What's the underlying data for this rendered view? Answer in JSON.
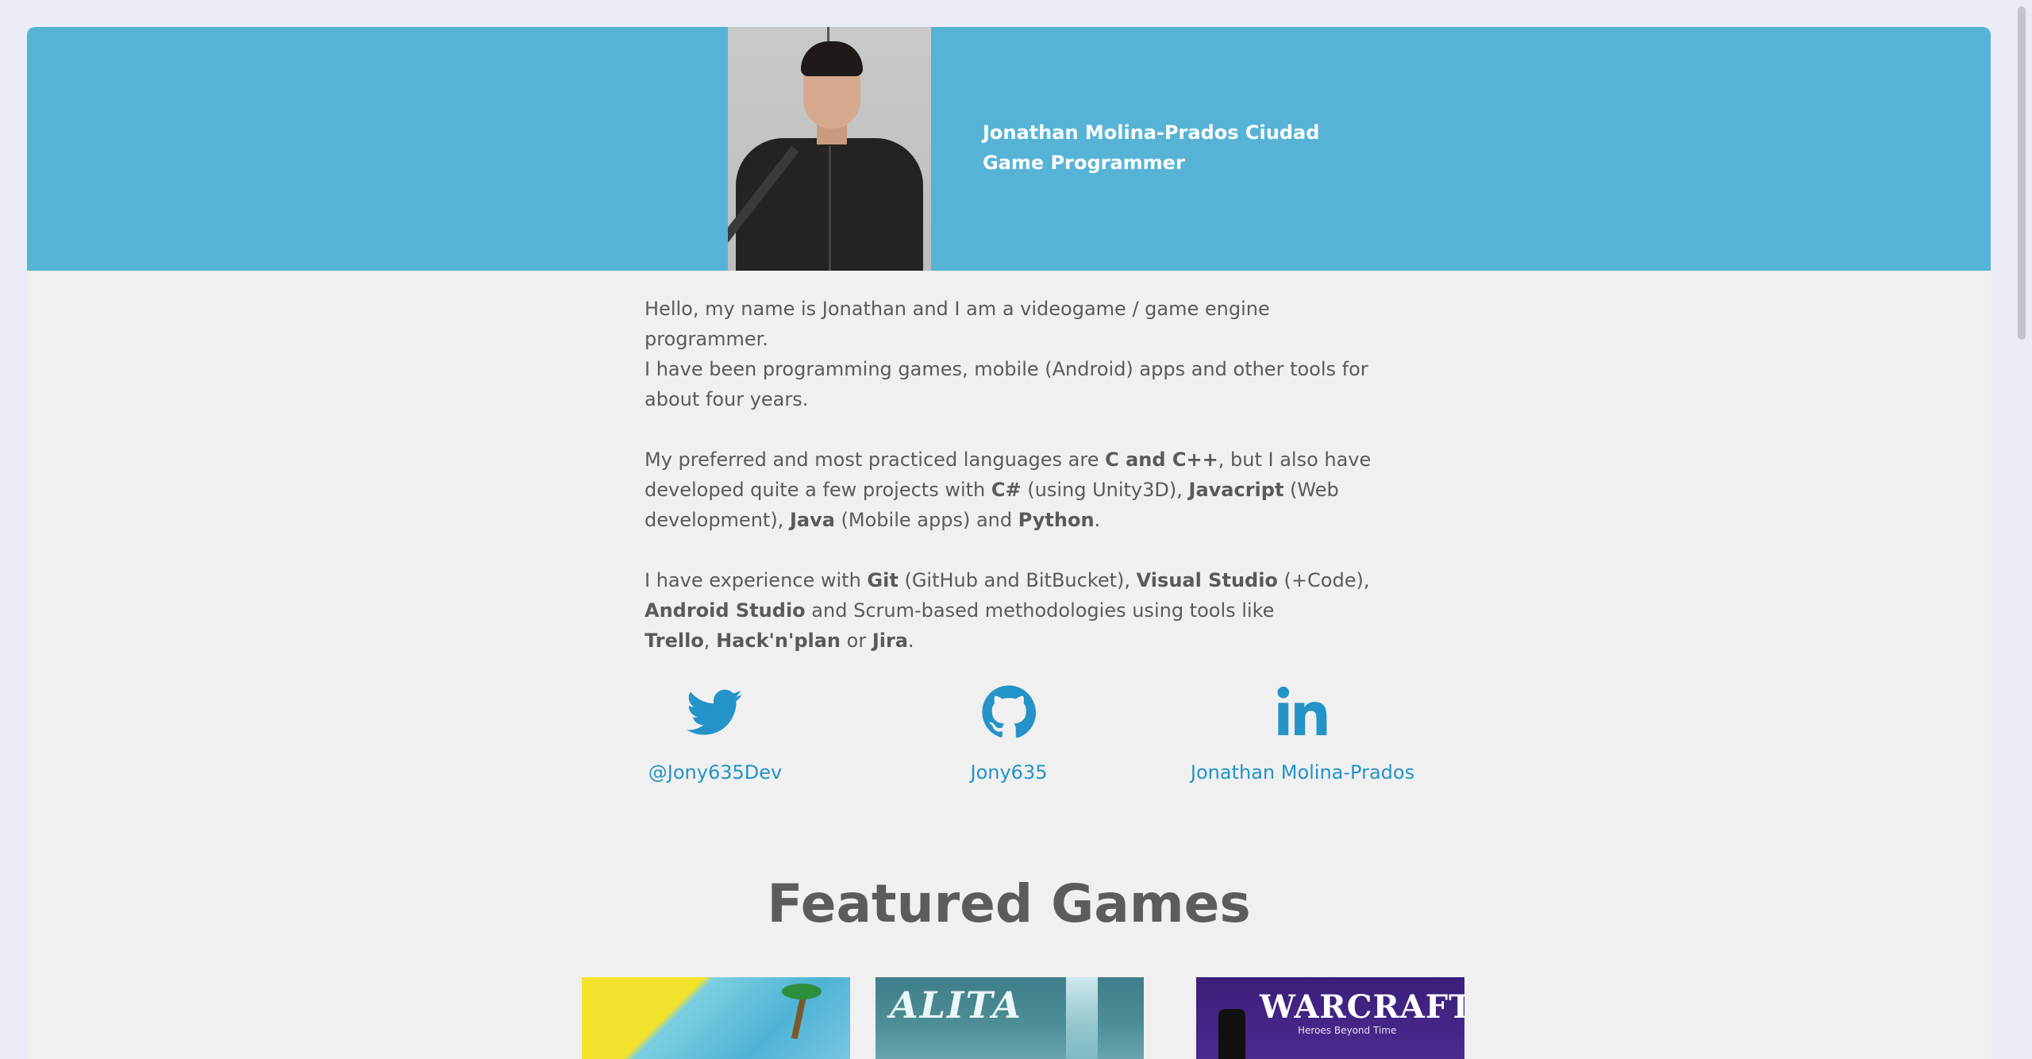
{
  "header": {
    "name": "Jonathan Molina-Prados Ciudad",
    "role": "Game Programmer"
  },
  "intro": {
    "p1_line1": "Hello, my name is Jonathan and I am a videogame / game engine programmer.",
    "p1_line2": "I have been programming games, mobile (Android) apps and other tools for about four years.",
    "p2": {
      "t1": "My preferred and most practiced languages are ",
      "b1": "C and C++",
      "t2": ", but I also have developed quite a few projects with ",
      "b2": "C#",
      "t3": " (using Unity3D), ",
      "b3": "Javacript",
      "t4": " (Web development), ",
      "b4": "Java",
      "t5": " (Mobile apps) and ",
      "b5": "Python",
      "t6": "."
    },
    "p3": {
      "t1": "I have experience with ",
      "b1": "Git",
      "t2": " (GitHub and BitBucket), ",
      "b2": "Visual Studio",
      "t3": " (+Code), ",
      "b3": "Android Studio",
      "t4": " and Scrum-based methodologies using tools like ",
      "b4": "Trello",
      "t5": ", ",
      "b5": "Hack'n'plan",
      "t6": " or ",
      "b6": "Jira",
      "t7": "."
    }
  },
  "social": [
    {
      "icon": "twitter-icon",
      "label": "@Jony635Dev"
    },
    {
      "icon": "github-icon",
      "label": "Jony635"
    },
    {
      "icon": "linkedin-icon",
      "label": "Jonathan Molina-Prados"
    }
  ],
  "featured": {
    "title": "Featured Games",
    "games": [
      {
        "name": "game-1"
      },
      {
        "name": "alita",
        "logo": "ALITA"
      },
      {
        "name": "warcraft",
        "logo": "WARCRAFT",
        "subtitle": "Heroes Beyond Time"
      }
    ]
  },
  "colors": {
    "header_bg": "#56b3d6",
    "link": "#2493c7",
    "text": "#5a5a5a",
    "page_bg": "#f0f0f0"
  }
}
